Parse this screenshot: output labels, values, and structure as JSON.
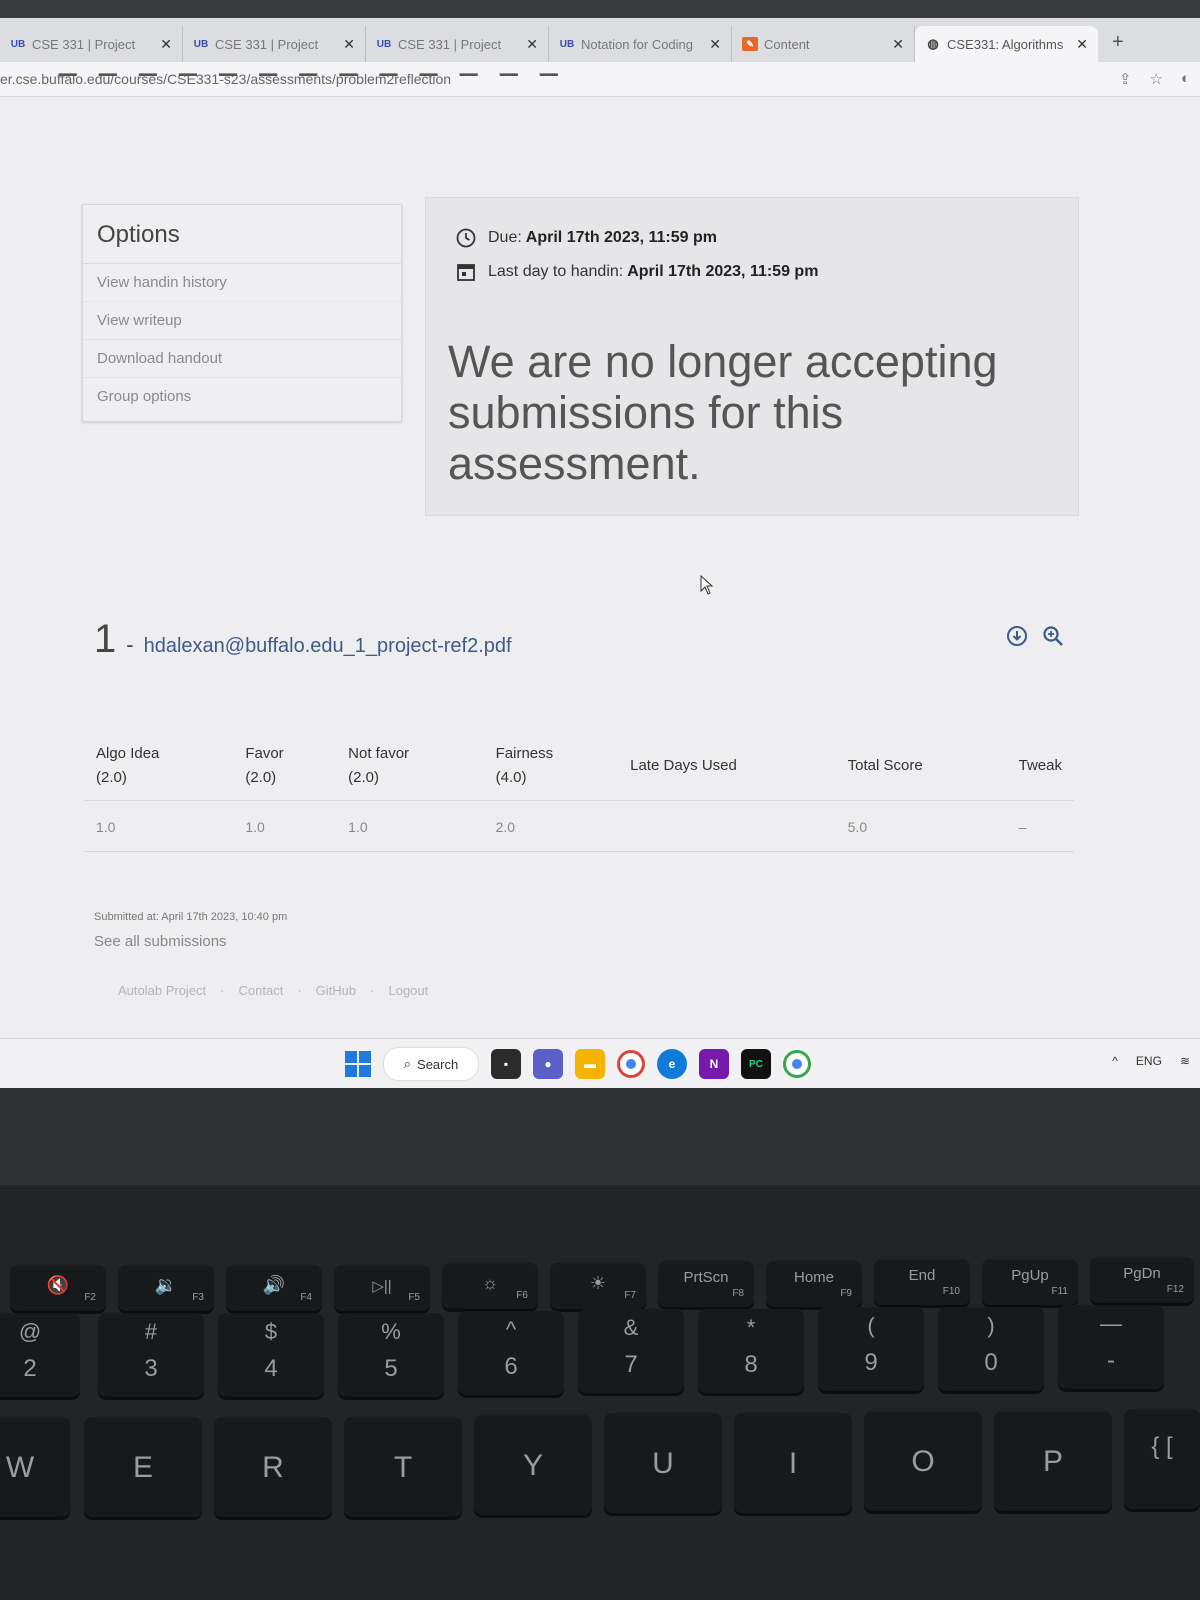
{
  "browser": {
    "tabs": [
      {
        "icon": "ub-icon",
        "title": "CSE 331 | Project",
        "active": false
      },
      {
        "icon": "ub-icon",
        "title": "CSE 331 | Project",
        "active": false
      },
      {
        "icon": "ub-icon",
        "title": "CSE 331 | Project",
        "active": false
      },
      {
        "icon": "ub-icon",
        "title": "Notation for Coding",
        "active": false
      },
      {
        "icon": "note-icon",
        "title": "Content",
        "active": false
      },
      {
        "icon": "globe-icon",
        "title": "CSE331: Algorithms",
        "active": true
      }
    ],
    "new_tab": "+",
    "url": "er.cse.buffalo.edu/courses/CSE331-s23/assessments/problem2reflection"
  },
  "options": {
    "title": "Options",
    "items": [
      "View handin history",
      "View writeup",
      "Download handout",
      "Group options"
    ]
  },
  "due": {
    "due_label": "Due:",
    "due_value": "April 17th 2023, 11:59 pm",
    "last_label": "Last day to handin:",
    "last_value": "April 17th 2023, 11:59 pm",
    "message": "We are no longer accepting submissions for this assessment."
  },
  "submission": {
    "number": "1",
    "dash": "-",
    "filename": "hdalexan@buffalo.edu_1_project-ref2.pdf",
    "columns": [
      {
        "name": "Algo Idea",
        "max": "(2.0)"
      },
      {
        "name": "Favor",
        "max": "(2.0)"
      },
      {
        "name": "Not favor",
        "max": "(2.0)"
      },
      {
        "name": "Fairness",
        "max": "(4.0)"
      },
      {
        "name": "Late Days Used",
        "max": ""
      },
      {
        "name": "Total Score",
        "max": ""
      },
      {
        "name": "Tweak",
        "max": ""
      }
    ],
    "values": [
      "1.0",
      "1.0",
      "1.0",
      "2.0",
      "",
      "5.0",
      "–"
    ],
    "submitted_at": "Submitted at: April 17th 2023, 10:40 pm",
    "see_all": "See all submissions"
  },
  "footer": [
    "Autolab Project",
    "·",
    "Contact",
    "·",
    "GitHub",
    "·",
    "Logout"
  ],
  "taskbar": {
    "search_label": "Search",
    "lang": "ENG",
    "apps": [
      "file-explorer-icon",
      "teams-icon",
      "folder-icon",
      "chrome-icon",
      "edge-icon",
      "onenote-icon",
      "pycharm-icon",
      "chrome-profile-icon"
    ]
  },
  "keyboard": {
    "fn_row": [
      {
        "label": "🔇",
        "fn": "F2"
      },
      {
        "label": "🔉",
        "fn": "F3"
      },
      {
        "label": "🔊",
        "fn": "F4"
      },
      {
        "label": "▷||",
        "fn": "F5"
      },
      {
        "label": "☼",
        "fn": "F6"
      },
      {
        "label": "☀",
        "fn": "F7"
      },
      {
        "label": "PrtScn",
        "fn": "F8"
      },
      {
        "label": "Home",
        "fn": "F9"
      },
      {
        "label": "End",
        "fn": "F10"
      },
      {
        "label": "PgUp",
        "fn": "F11"
      },
      {
        "label": "PgDn",
        "fn": "F12"
      }
    ],
    "num_row": [
      {
        "top": "@",
        "bottom": "2"
      },
      {
        "top": "#",
        "bottom": "3"
      },
      {
        "top": "$",
        "bottom": "4"
      },
      {
        "top": "%",
        "bottom": "5"
      },
      {
        "top": "^",
        "bottom": "6"
      },
      {
        "top": "&",
        "bottom": "7"
      },
      {
        "top": "*",
        "bottom": "8"
      },
      {
        "top": "(",
        "bottom": "9"
      },
      {
        "top": ")",
        "bottom": "0"
      },
      {
        "top": "—",
        "bottom": "-"
      }
    ],
    "letter_row": [
      "W",
      "E",
      "R",
      "T",
      "Y",
      "U",
      "I",
      "O",
      "P",
      "{ ["
    ]
  }
}
